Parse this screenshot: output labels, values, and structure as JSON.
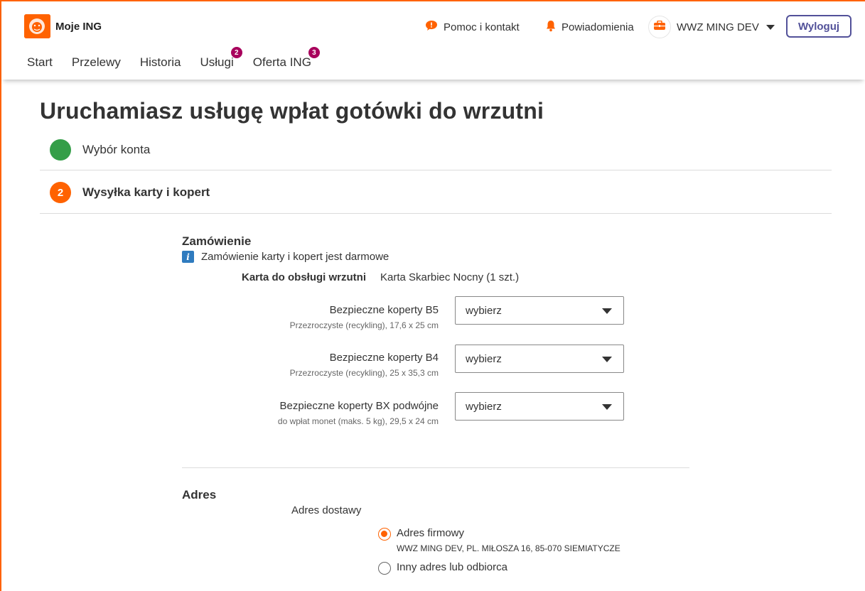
{
  "header": {
    "brand": "Moje ING",
    "help_label": "Pomoc i kontakt",
    "notifications_label": "Powiadomienia",
    "user_name": "WWZ MING DEV",
    "logout_label": "Wyloguj"
  },
  "nav": {
    "items": [
      {
        "label": "Start"
      },
      {
        "label": "Przelewy"
      },
      {
        "label": "Historia"
      },
      {
        "label": "Usługi",
        "badge": "2"
      },
      {
        "label": "Oferta ING",
        "badge": "3"
      }
    ]
  },
  "page": {
    "title": "Uruchamiasz usługę wpłat gotówki do wrzutni",
    "steps": [
      {
        "label": "Wybór konta",
        "status": "done"
      },
      {
        "number": "2",
        "label": "Wysyłka karty i kopert",
        "status": "active"
      }
    ]
  },
  "order": {
    "title": "Zamówienie",
    "info": "Zamówienie karty i kopert jest darmowe",
    "card_label": "Karta do obsługi wrzutni",
    "card_value": "Karta Skarbiec Nocny (1 szt.)",
    "fields": [
      {
        "label": "Bezpieczne koperty B5",
        "sub": "Przezroczyste (recykling), 17,6 x 25 cm",
        "value": "wybierz"
      },
      {
        "label": "Bezpieczne koperty B4",
        "sub": "Przezroczyste (recykling), 25 x 35,3 cm",
        "value": "wybierz"
      },
      {
        "label": "Bezpieczne koperty BX podwójne",
        "sub": "do wpłat monet (maks. 5 kg), 29,5 x 24 cm",
        "value": "wybierz"
      }
    ]
  },
  "address": {
    "title": "Adres",
    "delivery_label": "Adres dostawy",
    "options": [
      {
        "label": "Adres firmowy",
        "sub": "WWZ MING DEV, PL. MIŁOSZA 16, 85-070 SIEMIATYCZE",
        "checked": true
      },
      {
        "label": "Inny adres lub odbiorca",
        "checked": false
      }
    ]
  },
  "colors": {
    "brand_orange": "#ff6200",
    "done_green": "#349e48",
    "badge_purple": "#a8005c",
    "logout_blue": "#525199",
    "info_blue": "#2f7bbf"
  }
}
